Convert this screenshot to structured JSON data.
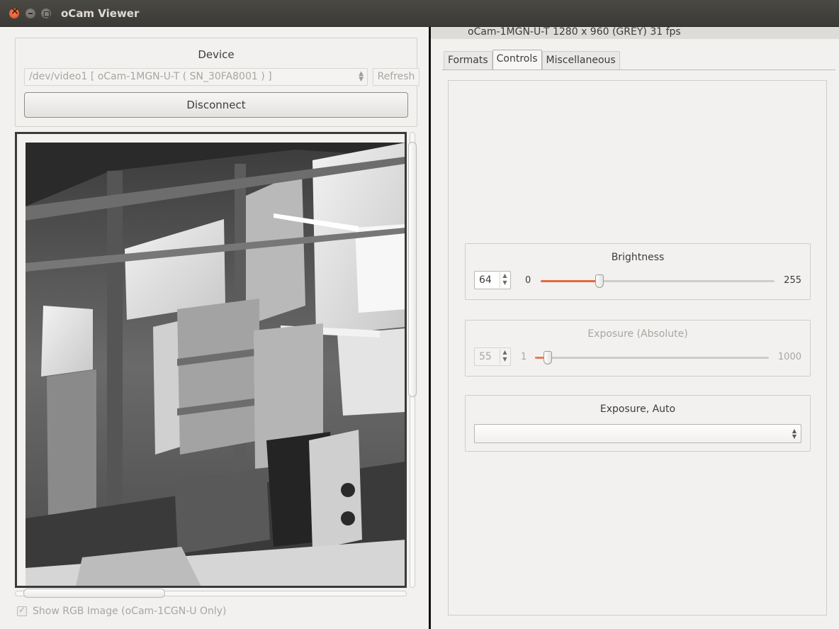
{
  "window": {
    "title": "oCam Viewer"
  },
  "device_panel": {
    "label": "Device",
    "device_value": "/dev/video1 [ oCam-1MGN-U-T ( SN_30FA8001 ) ]",
    "refresh_label": "Refresh",
    "disconnect_label": "Disconnect"
  },
  "preview": {
    "show_rgb_label": "Show RGB Image (oCam-1CGN-U Only)",
    "show_rgb_checked": true
  },
  "status": {
    "text": "oCam-1MGN-U-T  1280 x 960 (GREY)  31 fps"
  },
  "tabs": [
    {
      "label": "Formats",
      "active": false
    },
    {
      "label": "Controls",
      "active": true
    },
    {
      "label": "Miscellaneous",
      "active": false
    }
  ],
  "controls": {
    "brightness": {
      "title": "Brightness",
      "value": "64",
      "min": "0",
      "max": "255",
      "fraction": 0.251
    },
    "exposure_absolute": {
      "title": "Exposure (Absolute)",
      "value": "55",
      "min": "1",
      "max": "1000",
      "fraction": 0.054,
      "disabled": true
    },
    "exposure_auto": {
      "title": "Exposure, Auto",
      "value": ""
    }
  },
  "colors": {
    "slider_accent": "#e6683f",
    "titlebar": "#3b3a36",
    "close_button": "#df4a16"
  }
}
